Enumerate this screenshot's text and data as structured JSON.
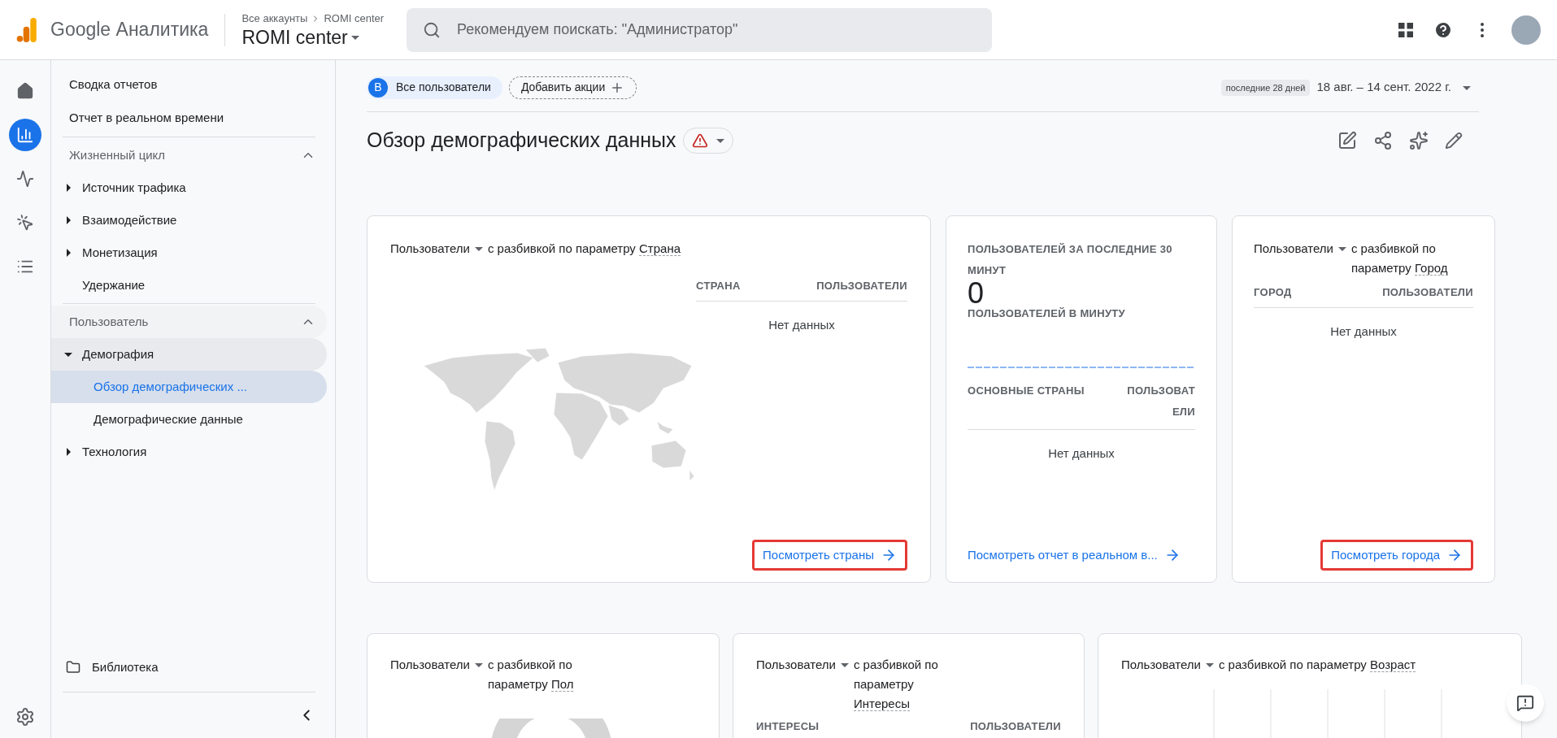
{
  "header": {
    "product": "Google Аналитика",
    "breadcrumb": [
      "Все аккаунты",
      "ROMI center"
    ],
    "property": "ROMI center",
    "search": {
      "placeholder": "Рекомендуем поискать: \"Администратор\""
    }
  },
  "rail": [
    {
      "kind": "home",
      "selected": false
    },
    {
      "kind": "reports",
      "selected": true
    },
    {
      "kind": "explore",
      "selected": false
    },
    {
      "kind": "advertising",
      "selected": false
    },
    {
      "kind": "configure",
      "selected": false
    }
  ],
  "sidebar": {
    "top": [
      {
        "label": "Сводка отчетов",
        "selected": false
      },
      {
        "label": "Отчет в реальном времени",
        "selected": false
      }
    ],
    "sections": [
      {
        "title": "Жизненный цикл",
        "expanded": true,
        "children": [
          {
            "label": "Источник трафика",
            "expandable": true,
            "expanded": false
          },
          {
            "label": "Взаимодействие",
            "expandable": true,
            "expanded": false
          },
          {
            "label": "Монетизация",
            "expandable": true,
            "expanded": false
          },
          {
            "label": "Удержание",
            "expandable": false,
            "expanded": false
          }
        ]
      },
      {
        "title": "Пользователь",
        "expanded": true,
        "children": [
          {
            "label": "Демография",
            "expandable": true,
            "expanded": true,
            "children": [
              {
                "label": "Обзор демографических ...",
                "selected": true
              },
              {
                "label": "Демографические данные",
                "selected": false
              }
            ]
          },
          {
            "label": "Технология",
            "expandable": true,
            "expanded": false
          }
        ]
      }
    ],
    "library": "Библиотека"
  },
  "filters": {
    "segment_badge": "В",
    "segment": "Все пользователи",
    "add": "Добавить акции"
  },
  "date": {
    "range_label": "последние 28 дней",
    "range": "18 авг. – 14 сент. 2022 г."
  },
  "title": "Обзор демографических данных",
  "cards": [
    {
      "kind": "map",
      "metric": "Пользователи",
      "prefix": "с разбивкой по параметру",
      "dimension": "Страна",
      "columns": [
        "СТРАНА",
        "ПОЛЬЗОВАТЕЛИ"
      ],
      "empty": "Нет данных",
      "link": "Посмотреть страны",
      "highlighted": true
    },
    {
      "kind": "realtime",
      "heading": "ПОЛЬЗОВАТЕЛЕЙ ЗА ПОСЛЕДНИЕ 30 МИНУТ",
      "value": "0",
      "subheading": "ПОЛЬЗОВАТЕЛЕЙ В МИНУТУ",
      "columns": [
        "ОСНОВНЫЕ СТРАНЫ",
        "ПОЛЬЗОВАТЕЛИ"
      ],
      "empty": "Нет данных",
      "link": "Посмотреть отчет в реальном в...",
      "highlighted": false
    },
    {
      "kind": "table",
      "metric": "Пользователи",
      "prefix": "с разбивкой по параметру",
      "dimension": "Город",
      "columns": [
        "ГОРОД",
        "ПОЛЬЗОВАТЕЛИ"
      ],
      "empty": "Нет данных",
      "link": "Посмотреть города",
      "highlighted": true
    }
  ],
  "cards_row2": [
    {
      "kind": "donut",
      "metric": "Пользователи",
      "prefix": "с разбивкой по параметру",
      "dimension": "Пол"
    },
    {
      "kind": "table",
      "metric": "Пользователи",
      "prefix": "с разбивкой по параметру",
      "dimension": "Интересы",
      "columns": [
        "ИНТЕРЕСЫ",
        "ПОЛЬЗОВАТЕЛИ"
      ]
    },
    {
      "kind": "bars",
      "metric": "Пользователи",
      "prefix": "с разбивкой по параметру",
      "dimension": "Возраст"
    }
  ]
}
